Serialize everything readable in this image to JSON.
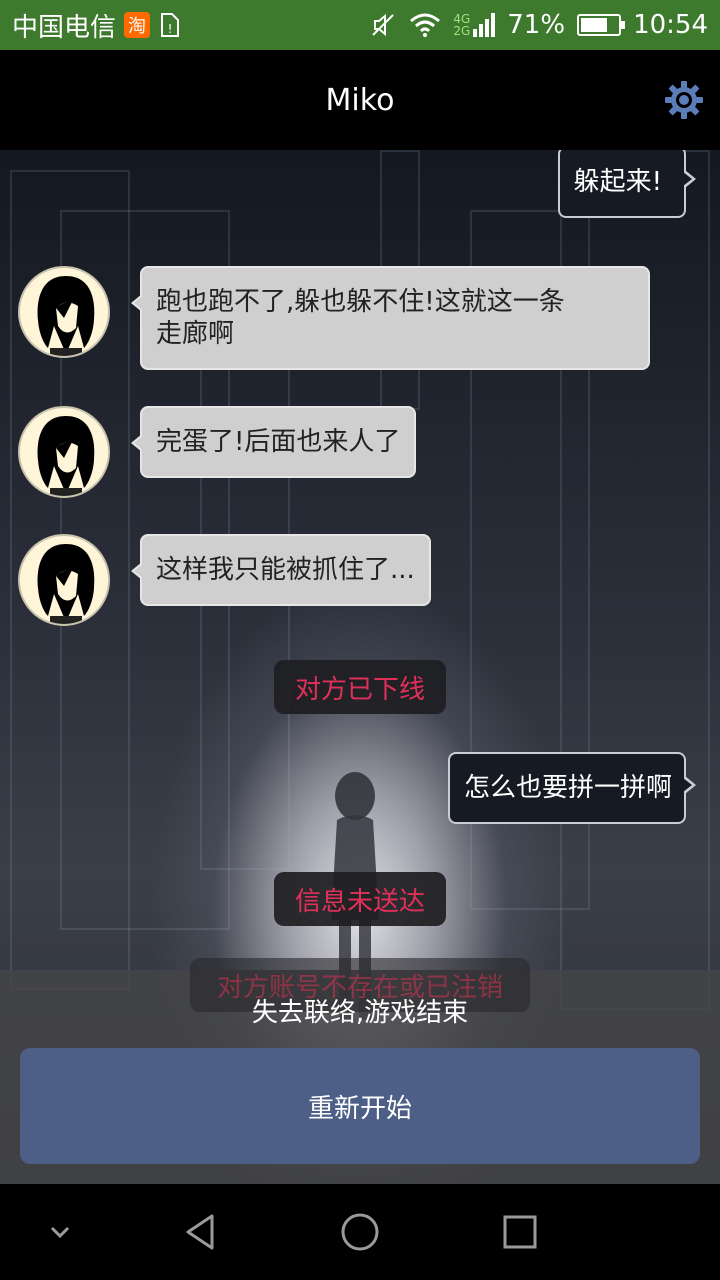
{
  "status_bar": {
    "carrier": "中国电信",
    "taobao_badge": "淘",
    "network": "4G",
    "network2": "2G",
    "battery": "71%",
    "battery_level": 0.71,
    "time": "10:54"
  },
  "header": {
    "title": "Miko"
  },
  "messages": [
    {
      "side": "out",
      "text": "躲起来!"
    },
    {
      "side": "in",
      "line1": "跑也跑不了,躲也躲不住!这就这一条",
      "line2": "走廊啊"
    },
    {
      "side": "in",
      "text": "完蛋了!后面也来人了"
    },
    {
      "side": "in",
      "text": "这样我只能被抓住了..."
    },
    {
      "side": "sys",
      "text": "对方已下线"
    },
    {
      "side": "out",
      "text": "怎么也要拼一拼啊"
    },
    {
      "side": "sys",
      "text": "信息未送达"
    },
    {
      "side": "sys",
      "text": "对方账号不存在或已注销"
    }
  ],
  "game_over": {
    "message": "失去联络,游戏结束",
    "restart_label": "重新开始"
  },
  "colors": {
    "status_bar": "#3d7a2e",
    "system_text": "#e0305a",
    "restart_button": "#4d5f87"
  }
}
